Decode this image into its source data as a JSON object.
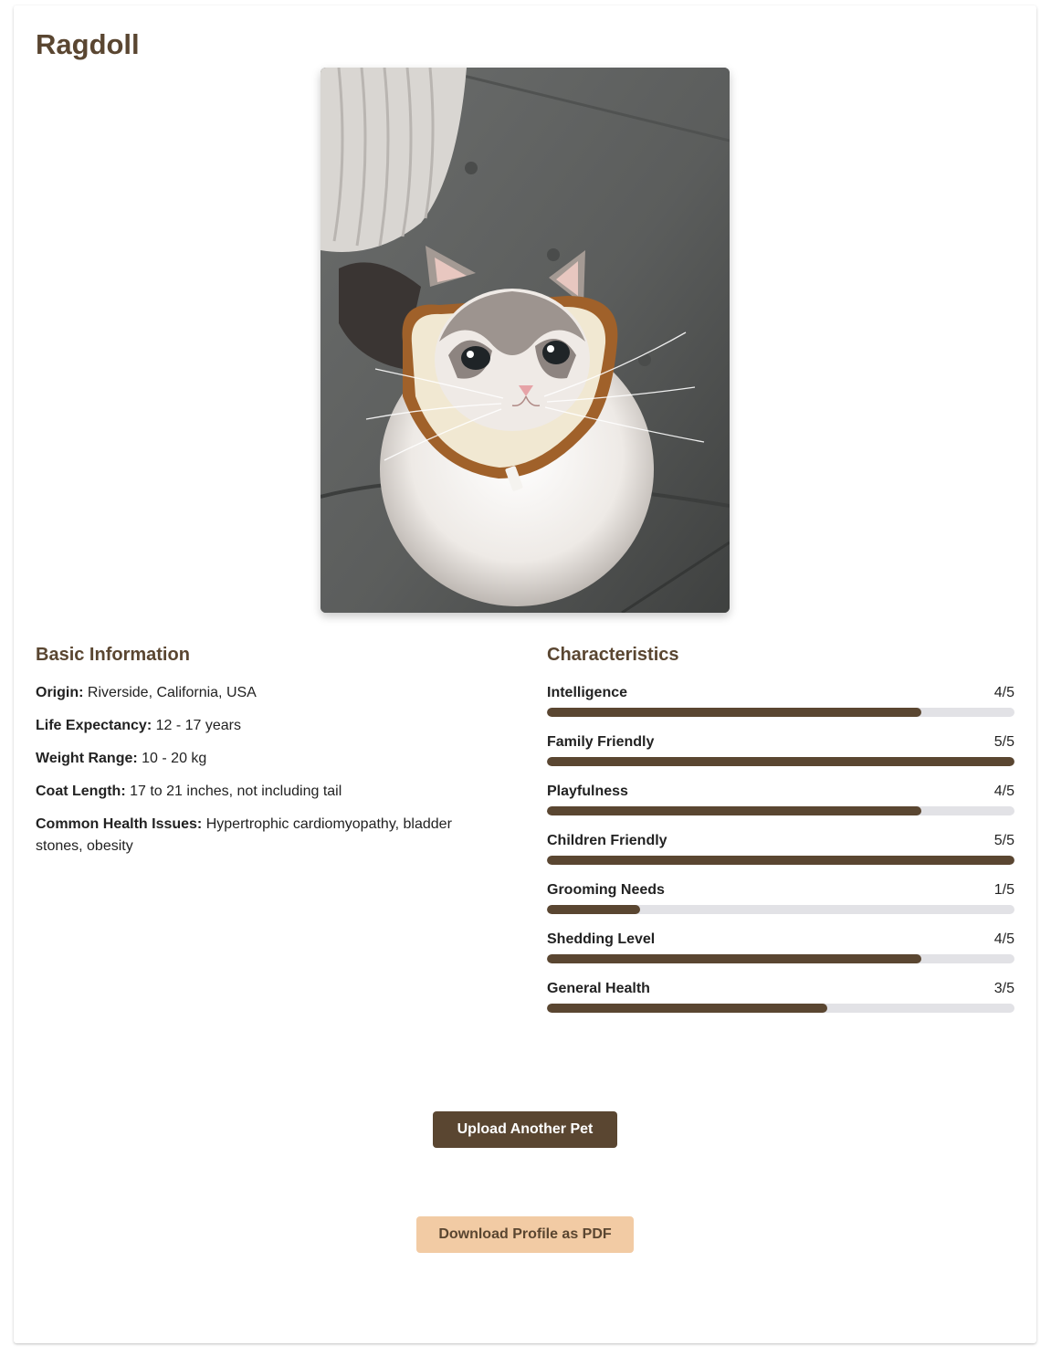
{
  "profile": {
    "breed_name": "Ragdoll",
    "photo_alt": "Ragdoll cat wearing a bread-slice collar"
  },
  "basic_info": {
    "heading": "Basic Information",
    "items": [
      {
        "label": "Origin:",
        "value": "Riverside, California, USA"
      },
      {
        "label": "Life Expectancy:",
        "value": "12 - 17 years"
      },
      {
        "label": "Weight Range:",
        "value": "10 - 20 kg"
      },
      {
        "label": "Coat Length:",
        "value": "17 to 21 inches, not including tail"
      },
      {
        "label": "Common Health Issues:",
        "value": "Hypertrophic cardiomyopathy, bladder stones, obesity"
      }
    ]
  },
  "characteristics": {
    "heading": "Characteristics",
    "items": [
      {
        "name": "Intelligence",
        "score_text": "4/5",
        "level_percent": 80
      },
      {
        "name": "Family Friendly",
        "score_text": "5/5",
        "level_percent": 100
      },
      {
        "name": "Playfulness",
        "score_text": "4/5",
        "level_percent": 80
      },
      {
        "name": "Children Friendly",
        "score_text": "5/5",
        "level_percent": 100
      },
      {
        "name": "Grooming Needs",
        "score_text": "1/5",
        "level_percent": 20
      },
      {
        "name": "Shedding Level",
        "score_text": "4/5",
        "level_percent": 80
      },
      {
        "name": "General Health",
        "score_text": "3/5",
        "level_percent": 60
      }
    ]
  },
  "actions": {
    "upload_label": "Upload Another Pet",
    "download_label": "Download Profile as PDF"
  },
  "colors": {
    "accent_brown": "#5a4631",
    "bar_track": "#e2e2e6",
    "pdf_button": "#f2cba4"
  }
}
